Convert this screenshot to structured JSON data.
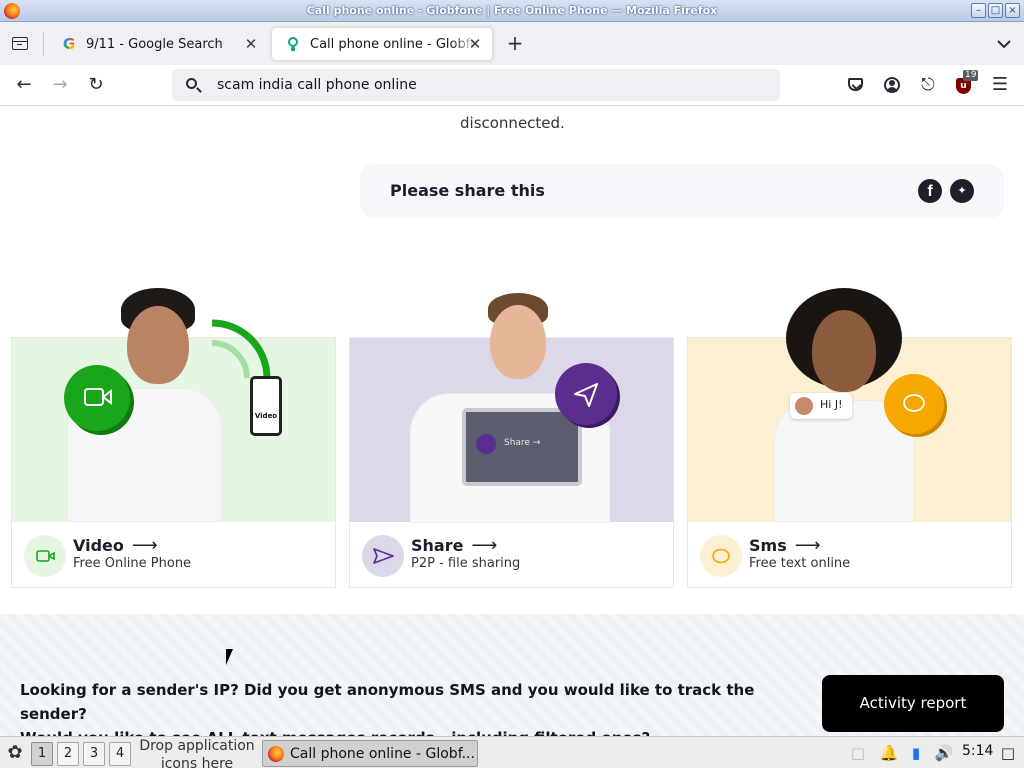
{
  "window": {
    "title": "Call phone online - Globfone | Free Online Phone — Mozilla Firefox"
  },
  "tabs": [
    {
      "label": "9/11 - Google Search",
      "favicon": "google-icon"
    },
    {
      "label": "Call phone online - Globfone | Free Online Phone",
      "favicon": "bulb-icon"
    }
  ],
  "navbar": {
    "url": "scam india call phone online",
    "ublock_count": "19"
  },
  "page": {
    "cut_text": "properly working ... disconnected",
    "disconnected_text": "disconnected.",
    "share_text": "Please share this",
    "cards": [
      {
        "title": "Video",
        "subtitle": "Free Online Phone",
        "hero_label": "Video",
        "accent": "#1aa61a"
      },
      {
        "title": "Share",
        "subtitle": "P2P - file sharing",
        "hero_label": "Share →",
        "accent": "#5b2d8e"
      },
      {
        "title": "Sms",
        "subtitle": "Free text online",
        "hero_label": "Hi J!",
        "accent": "#f6a800"
      }
    ],
    "banner_line1": "Looking for a sender's IP? Did you get anonymous SMS and you would like to track the sender?",
    "banner_line2": "Would you like to see ALL text messages records - including filtered ones?",
    "activity_button": "Activity report"
  },
  "taskbar": {
    "workspaces": [
      "1",
      "2",
      "3",
      "4"
    ],
    "drop_label": "Drop application icons here",
    "task_label": "Call phone online - Globf...",
    "clock": "5:14"
  },
  "colors": {
    "video_bg": "#e5f7e3",
    "share_bg": "#ddd7ea",
    "sms_bg": "#fdefd2",
    "button_bg": "#000000"
  }
}
